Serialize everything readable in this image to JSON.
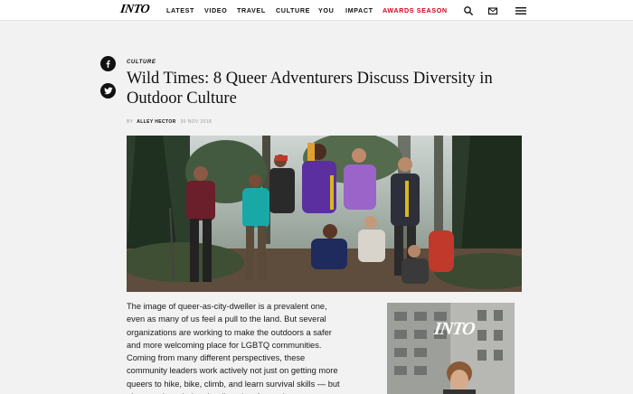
{
  "brand": {
    "logo_text": "INTO"
  },
  "nav": {
    "items": [
      {
        "label": "LATEST"
      },
      {
        "label": "VIDEO"
      },
      {
        "label": "TRAVEL"
      },
      {
        "label": "CULTURE"
      },
      {
        "label": "YOU"
      },
      {
        "label": "IMPACT"
      },
      {
        "label": "AWARDS SEASON"
      }
    ],
    "icons": [
      "search-icon",
      "mail-icon",
      "menu-icon"
    ],
    "accent_color": "#d0021b"
  },
  "social": {
    "icons": [
      "facebook-icon",
      "twitter-icon"
    ]
  },
  "article": {
    "category": "CULTURE",
    "title": "Wild Times: 8 Queer Adventurers Discuss Diversity in Outdoor Culture",
    "byline_prefix": "BY",
    "author": "ALLEY HECTOR",
    "date": "30 NOV 2018",
    "body": "The image of queer-as-city-dweller is a prevalent one, even as many of us feel a pull to the land. But several organizations are working to make the outdoors a safer and more welcoming place for LGBTQ communities. Coming from many different perspectives, these community leaders work actively not just on getting more queers to hike, bike, climb, and learn survival skills — but also to acknowledge the diversity of experience"
  },
  "sidebar_ad": {
    "logo_text": "INTO"
  }
}
